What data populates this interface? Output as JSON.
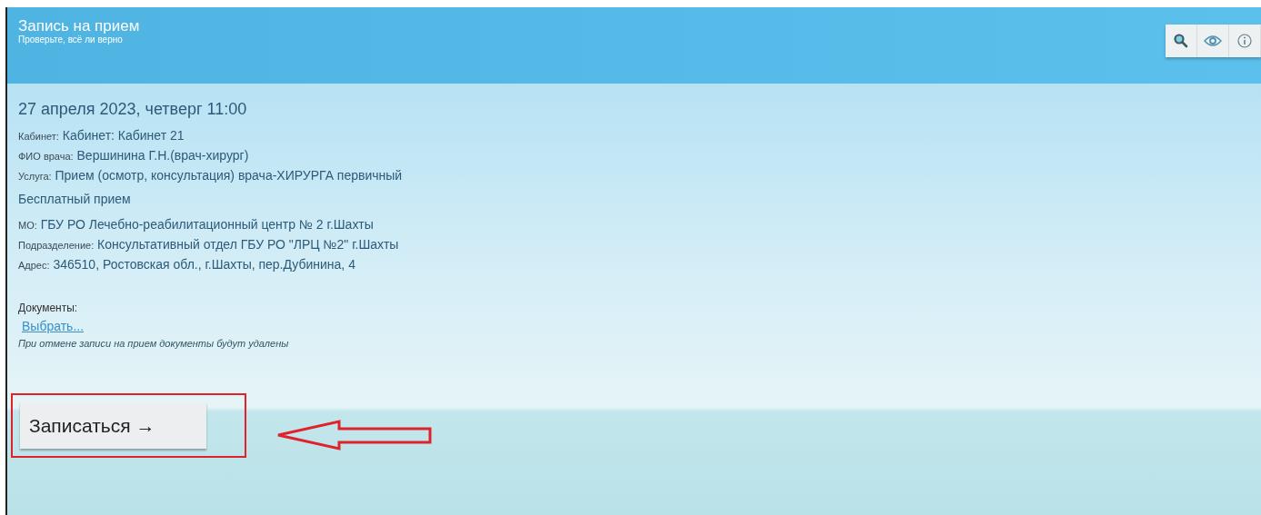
{
  "header": {
    "title": "Запись на прием",
    "subtitle": "Проверьте, всё ли верно"
  },
  "toolbar": [
    {
      "kind": "search"
    },
    {
      "kind": "eye"
    },
    {
      "kind": "info"
    }
  ],
  "appointment": {
    "datetime": "27 апреля 2023, четверг 11:00",
    "details": [
      {
        "label": "Кабинет:",
        "value": "Кабинет: Кабинет 21"
      },
      {
        "label": "ФИО врача:",
        "value": "Вершинина Г.Н.(врач-хирург)"
      },
      {
        "label": "Услуга:",
        "value": "Прием (осмотр, консультация) врача-ХИРУРГА первичный"
      }
    ],
    "payment": "Бесплатный прием",
    "organization": [
      {
        "label": "МО:",
        "value": "ГБУ РО Лечебно-реабилитационный центр № 2 г.Шахты"
      },
      {
        "label": "Подразделение:",
        "value": "Консультативный отдел ГБУ РО \"ЛРЦ №2\" г.Шахты"
      },
      {
        "label": "Адрес:",
        "value": "346510, Ростовская обл., г.Шахты, пер.Дубинина, 4"
      }
    ]
  },
  "documents": {
    "label": "Документы:",
    "link": "Выбрать...",
    "note": "При отмене записи на прием документы будут удалены"
  },
  "submit_button": "Записаться →"
}
